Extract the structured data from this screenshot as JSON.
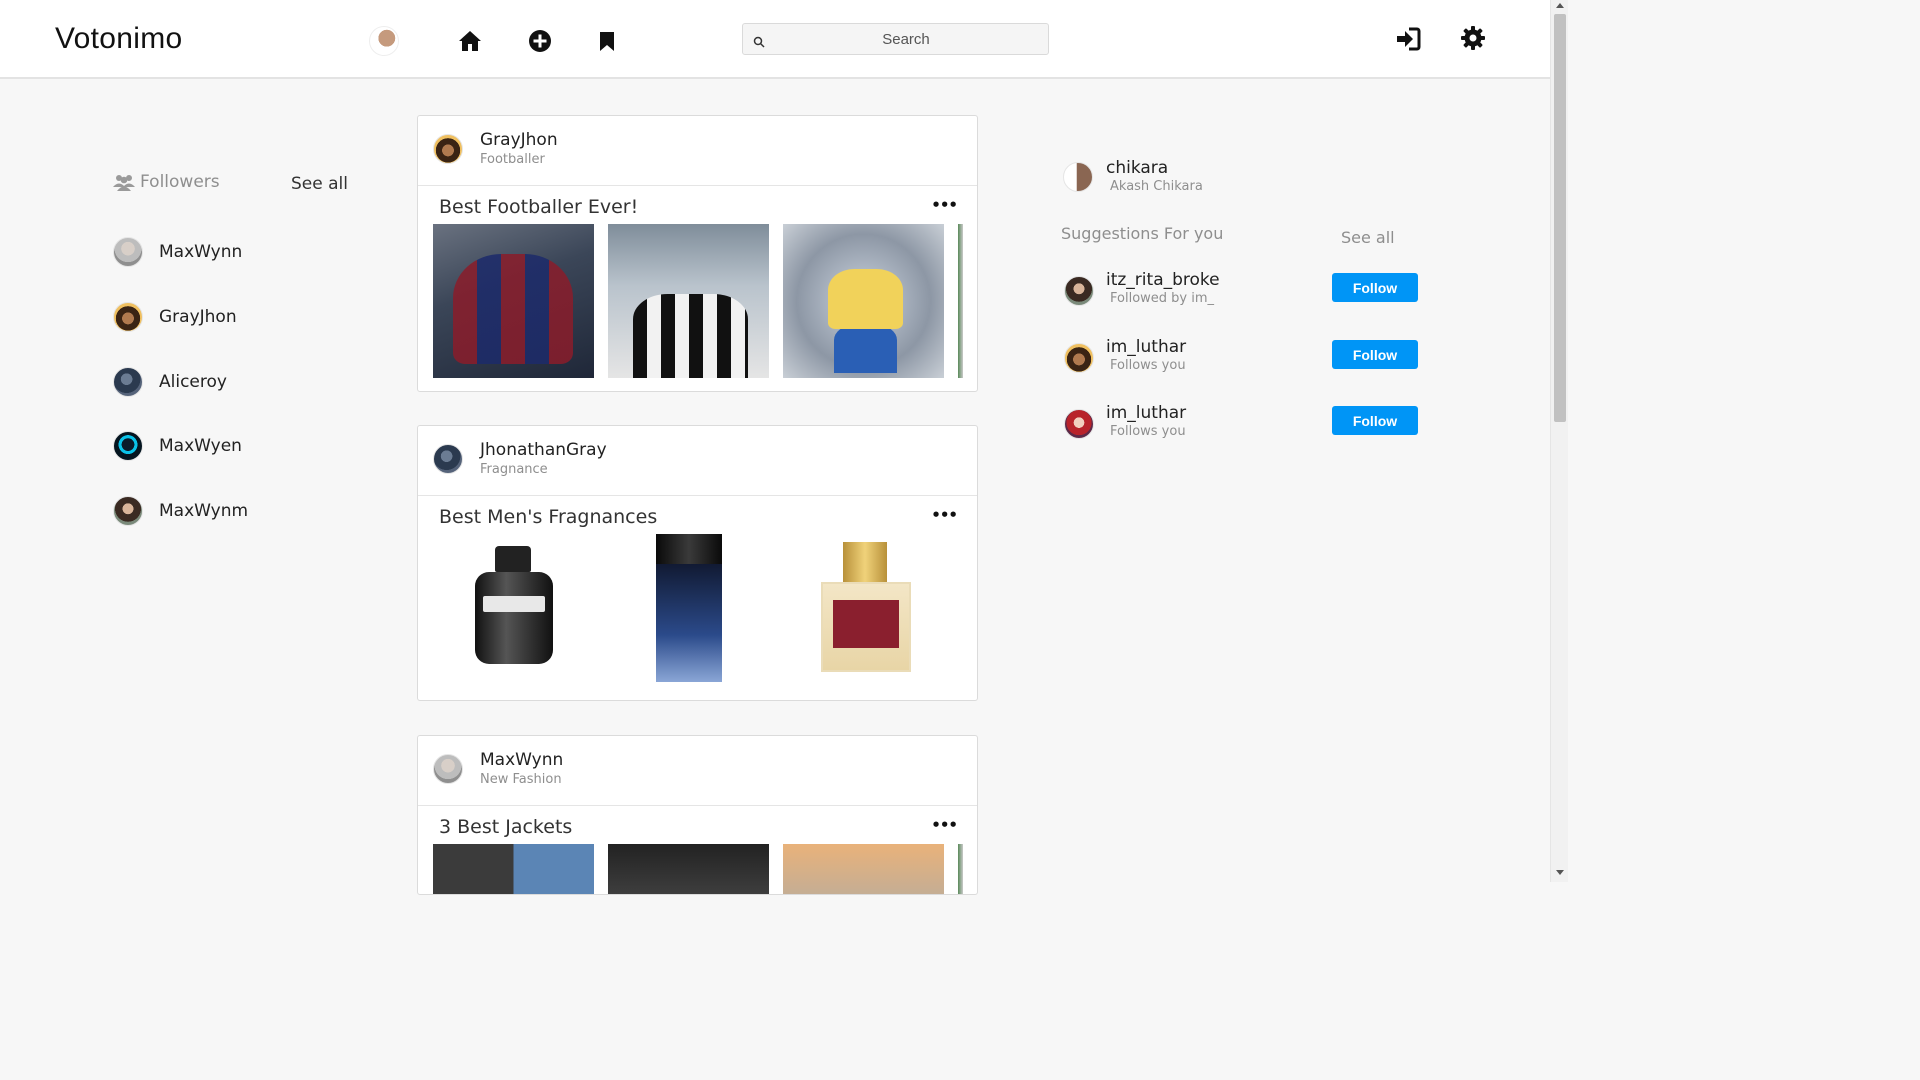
{
  "app": {
    "title": "Votonimo"
  },
  "navbar": {
    "search_placeholder": "Search",
    "icons": [
      "home-icon",
      "add-circle-icon",
      "bookmark-icon",
      "login-icon",
      "gear-icon",
      "search-icon"
    ]
  },
  "followers": {
    "heading": "Followers",
    "see_all": "See all",
    "items": [
      {
        "name": "MaxWynn"
      },
      {
        "name": "GrayJhon"
      },
      {
        "name": "Aliceroy"
      },
      {
        "name": "MaxWyen"
      },
      {
        "name": "MaxWynm"
      }
    ]
  },
  "posts": [
    {
      "user": "GrayJhon",
      "category": "Footballer",
      "title": "Best Footballer Ever!",
      "more": "•••"
    },
    {
      "user": "JhonathanGray",
      "category": "Fragnance",
      "title": "Best Men's Fragnances",
      "more": "•••"
    },
    {
      "user": "MaxWynn",
      "category": "New Fashion",
      "title": "3 Best Jackets",
      "more": "•••"
    }
  ],
  "profile": {
    "username": "chikara",
    "full_name": "Akash Chikara"
  },
  "suggestions": {
    "heading": "Suggestions For you",
    "see_all": "See all",
    "items": [
      {
        "username": "itz_rita_broke",
        "subtitle": "Followed by im_",
        "button": "Follow"
      },
      {
        "username": "im_luthar",
        "subtitle": "Follows you",
        "button": "Follow"
      },
      {
        "username": "im_luthar",
        "subtitle": "Follows you",
        "button": "Follow"
      }
    ]
  },
  "colors": {
    "accent": "#0095f6",
    "background": "#f7f7f7",
    "muted": "#8e8e8e"
  }
}
